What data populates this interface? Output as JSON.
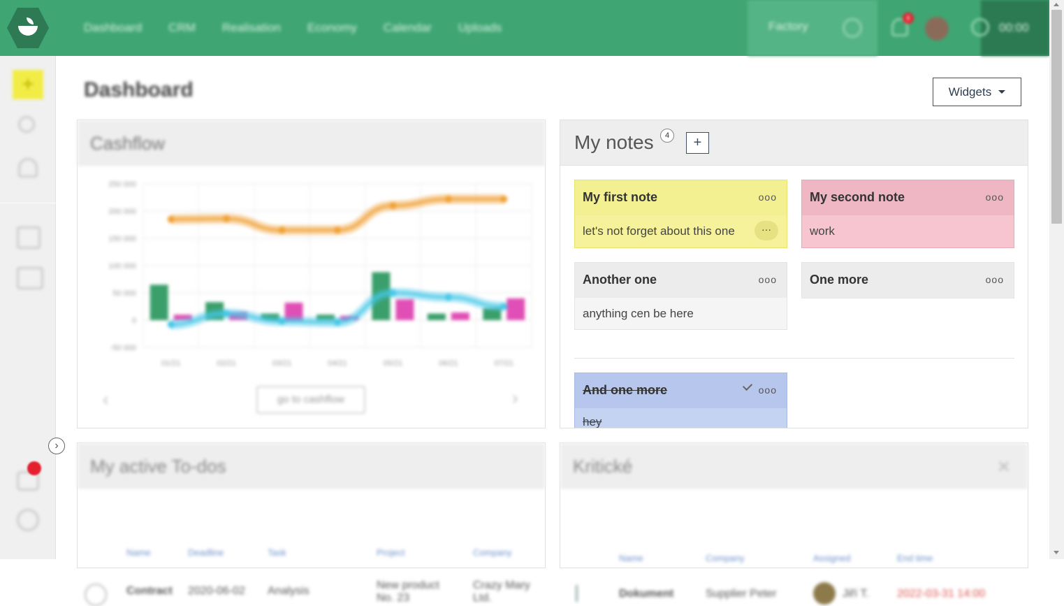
{
  "nav": {
    "items": [
      "Dashboard",
      "CRM",
      "Realisation",
      "Economy",
      "Calendar",
      "Uploads"
    ],
    "factory": "Factory",
    "notif_count": "8",
    "timer": "00:00"
  },
  "page": {
    "title": "Dashboard",
    "widgets_label": "Widgets"
  },
  "cashflow": {
    "title": "Cashflow",
    "goto_label": "go to cashflow",
    "prev": "‹",
    "next": "›"
  },
  "chart_data": {
    "type": "bar",
    "categories": [
      "01/21",
      "02/21",
      "03/21",
      "04/21",
      "05/21",
      "06/21",
      "07/21"
    ],
    "ylim": [
      -50000,
      250000
    ],
    "yticks": [
      "250 000",
      "200 000",
      "150 000",
      "100 000",
      "50 000",
      "0",
      "-50 000"
    ],
    "series": [
      {
        "type": "bar",
        "color": "#3a9f6b",
        "values": [
          65000,
          33000,
          12000,
          10000,
          88000,
          12000,
          22000
        ]
      },
      {
        "type": "bar",
        "color": "#e04fb5",
        "values": [
          10000,
          15000,
          32000,
          8000,
          38000,
          14000,
          40000
        ]
      },
      {
        "type": "line",
        "color": "#f0a035",
        "values": [
          185000,
          186000,
          165000,
          165000,
          210000,
          222000,
          222000
        ]
      },
      {
        "type": "line",
        "color": "#46c8e8",
        "values": [
          -8000,
          12000,
          -2000,
          -4000,
          50000,
          42000,
          25000
        ]
      }
    ]
  },
  "notes": {
    "title": "My notes",
    "count": "4",
    "add": "+",
    "items": [
      {
        "title": "My first note",
        "body": "let's not forget about this one",
        "more": "ooo",
        "dots": "···"
      },
      {
        "title": "My second note",
        "body": "work",
        "more": "ooo"
      },
      {
        "title": "Another one",
        "body": "anything cen be here",
        "more": "ooo"
      },
      {
        "title": "One more",
        "more": "ooo"
      },
      {
        "title": "And one more",
        "body": "hey",
        "more": "ooo"
      }
    ]
  },
  "todos": {
    "title": "My active To-dos",
    "headers": [
      "Name",
      "Deadline",
      "Task",
      "Project",
      "Company"
    ],
    "row": [
      "Contract",
      "2020-06-02",
      "Analysis",
      "New product No. 23",
      "Crazy Mary Ltd."
    ]
  },
  "kriticke": {
    "title": "Kritické",
    "headers": [
      "Name",
      "Company",
      "Assigned",
      "End time"
    ],
    "row": [
      "Dokument",
      "Supplier Peter",
      "Jiří T.",
      "2022-03-31 14:00"
    ]
  },
  "colors": {
    "brand_green": "#3fa673",
    "accent_yellow": "#f2ec46",
    "note_yellow": "#f5f29b",
    "note_pink": "#f7c5d0",
    "note_blue": "#c5d3f2"
  }
}
